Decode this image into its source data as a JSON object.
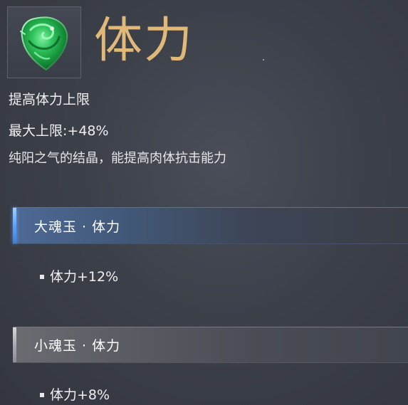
{
  "item": {
    "icon": "green-jade-icon",
    "title": "体力",
    "subtitle": "提高体力上限",
    "max_limit": "最大上限:+48%",
    "description": "纯阳之气的结晶，能提高肉体抗击能力"
  },
  "tiers": [
    {
      "name": "大魂玉 · 体力",
      "bonus": "体力+12%",
      "accent": "#5aa2ff"
    },
    {
      "name": "小魂玉 · 体力",
      "bonus": "体力+8%",
      "accent": "#a9abb0"
    }
  ],
  "colors": {
    "title": "#e0b978",
    "background": "#3c4049",
    "jade": "#1fae4a"
  }
}
